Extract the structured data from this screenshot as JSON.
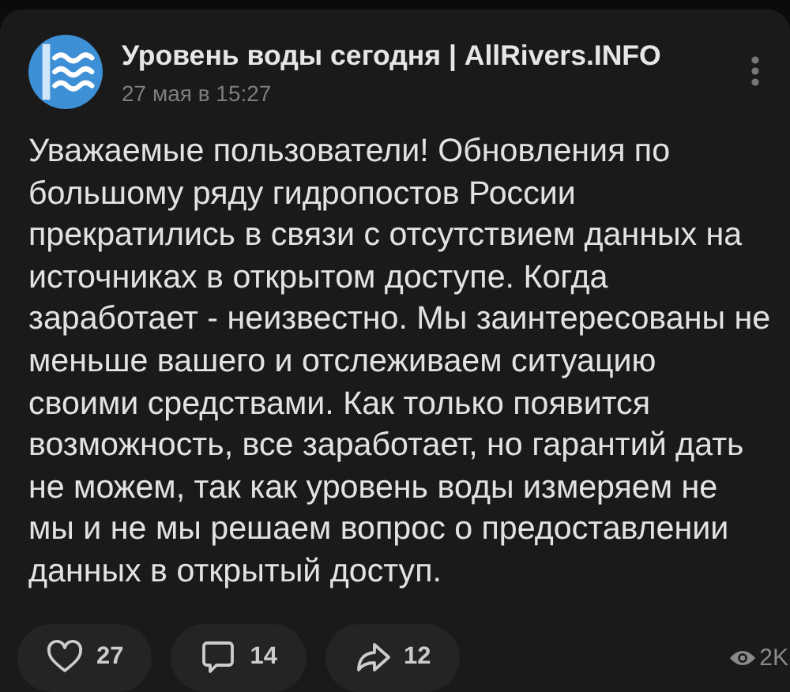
{
  "post": {
    "author": "Уровень воды сегодня | AllRivers.INFO",
    "date": "27 мая в 15:27",
    "text": "Уважаемые пользователи! Обновления по большому ряду гидропостов России прекратились в связи с отсутствием данных на источниках в открытом доступе. Когда заработает - неизвестно. Мы заинтересованы не меньше вашего и отслеживаем ситуацию своими средствами. Как только появится возможность, все заработает, но гарантий дать не можем, так как уровень воды измеряем не мы и не мы решаем вопрос о предоставлении данных в открытый доступ."
  },
  "actions": [
    {
      "kind": "like",
      "count": "27"
    },
    {
      "kind": "comment",
      "count": "14"
    },
    {
      "kind": "share",
      "count": "12"
    }
  ],
  "views": "2K"
}
